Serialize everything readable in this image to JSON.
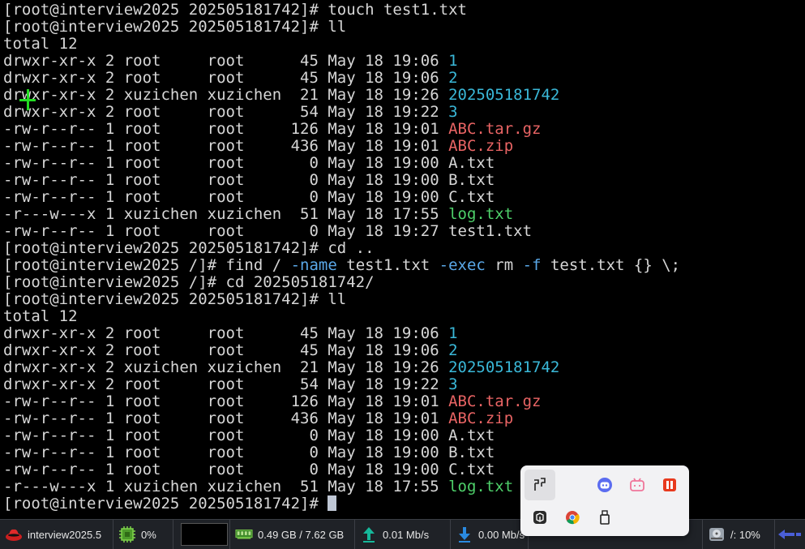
{
  "terminal": {
    "lines": [
      [
        {
          "t": "[root@interview2025 202505181742]# touch test1.txt"
        }
      ],
      [
        {
          "t": "[root@interview2025 202505181742]# ll"
        }
      ],
      [
        {
          "t": "total 12"
        }
      ],
      [
        {
          "t": "drwxr-xr-x 2 root     root      45 May 18 19:06 "
        },
        {
          "t": "1",
          "c": "dir"
        }
      ],
      [
        {
          "t": "drwxr-xr-x 2 root     root      45 May 18 19:06 "
        },
        {
          "t": "2",
          "c": "dir"
        }
      ],
      [
        {
          "t": "drwxr-xr-x 2 xuzichen xuzichen  21 May 18 19:26 "
        },
        {
          "t": "202505181742",
          "c": "dir"
        }
      ],
      [
        {
          "t": "drwxr-xr-x 2 root     root      54 May 18 19:22 "
        },
        {
          "t": "3",
          "c": "dir"
        }
      ],
      [
        {
          "t": "-rw-r--r-- 1 root     root     126 May 18 19:01 "
        },
        {
          "t": "ABC.tar.gz",
          "c": "arc"
        }
      ],
      [
        {
          "t": "-rw-r--r-- 1 root     root     436 May 18 19:01 "
        },
        {
          "t": "ABC.zip",
          "c": "arc"
        }
      ],
      [
        {
          "t": "-rw-r--r-- 1 root     root       0 May 18 19:00 A.txt"
        }
      ],
      [
        {
          "t": "-rw-r--r-- 1 root     root       0 May 18 19:00 B.txt"
        }
      ],
      [
        {
          "t": "-rw-r--r-- 1 root     root       0 May 18 19:00 C.txt"
        }
      ],
      [
        {
          "t": "-r---w---x 1 xuzichen xuzichen  51 May 18 17:55 "
        },
        {
          "t": "log.txt",
          "c": "exe"
        }
      ],
      [
        {
          "t": "-rw-r--r-- 1 root     root       0 May 18 19:27 test1.txt"
        }
      ],
      [
        {
          "t": "[root@interview2025 202505181742]# cd .."
        }
      ],
      [
        {
          "t": "[root@interview2025 /]# find / "
        },
        {
          "t": "-name",
          "c": "opt"
        },
        {
          "t": " test1.txt "
        },
        {
          "t": "-exec",
          "c": "opt"
        },
        {
          "t": " rm "
        },
        {
          "t": "-f",
          "c": "opt"
        },
        {
          "t": " test.txt {} \\;"
        }
      ],
      [
        {
          "t": "[root@interview2025 /]# cd 202505181742/"
        }
      ],
      [
        {
          "t": "[root@interview2025 202505181742]# ll"
        }
      ],
      [
        {
          "t": "total 12"
        }
      ],
      [
        {
          "t": "drwxr-xr-x 2 root     root      45 May 18 19:06 "
        },
        {
          "t": "1",
          "c": "dir"
        }
      ],
      [
        {
          "t": "drwxr-xr-x 2 root     root      45 May 18 19:06 "
        },
        {
          "t": "2",
          "c": "dir"
        }
      ],
      [
        {
          "t": "drwxr-xr-x 2 xuzichen xuzichen  21 May 18 19:26 "
        },
        {
          "t": "202505181742",
          "c": "dir"
        }
      ],
      [
        {
          "t": "drwxr-xr-x 2 root     root      54 May 18 19:22 "
        },
        {
          "t": "3",
          "c": "dir"
        }
      ],
      [
        {
          "t": "-rw-r--r-- 1 root     root     126 May 18 19:01 "
        },
        {
          "t": "ABC.tar.gz",
          "c": "arc"
        }
      ],
      [
        {
          "t": "-rw-r--r-- 1 root     root     436 May 18 19:01 "
        },
        {
          "t": "ABC.zip",
          "c": "arc"
        }
      ],
      [
        {
          "t": "-rw-r--r-- 1 root     root       0 May 18 19:00 A.txt"
        }
      ],
      [
        {
          "t": "-rw-r--r-- 1 root     root       0 May 18 19:00 B.txt"
        }
      ],
      [
        {
          "t": "-rw-r--r-- 1 root     root       0 May 18 19:00 C.txt"
        }
      ],
      [
        {
          "t": "-r---w---x 1 xuzichen xuzichen  51 May 18 17:55 "
        },
        {
          "t": "log.txt",
          "c": "exe"
        }
      ],
      [
        {
          "t": "[root@interview2025 202505181742]# "
        }
      ]
    ],
    "colors": {
      "dir": "#3ab8d8",
      "archive": "#e96464",
      "executable": "#4ed06a",
      "option": "#5aa8e8"
    }
  },
  "taskbar": {
    "host_label": "interview2025.5",
    "cpu": "0%",
    "memory": "0.49 GB / 7.62 GB",
    "upload": "0.01 Mb/s",
    "download": "0.00 Mb/s",
    "disk": "/: 10%"
  },
  "tray": {
    "icons": [
      "pinyin-input-icon",
      "assistant-bot-icon",
      "bilibili-icon",
      "red-app-icon",
      "box-app-icon",
      "chrome-icon",
      "usb-drive-icon"
    ]
  }
}
